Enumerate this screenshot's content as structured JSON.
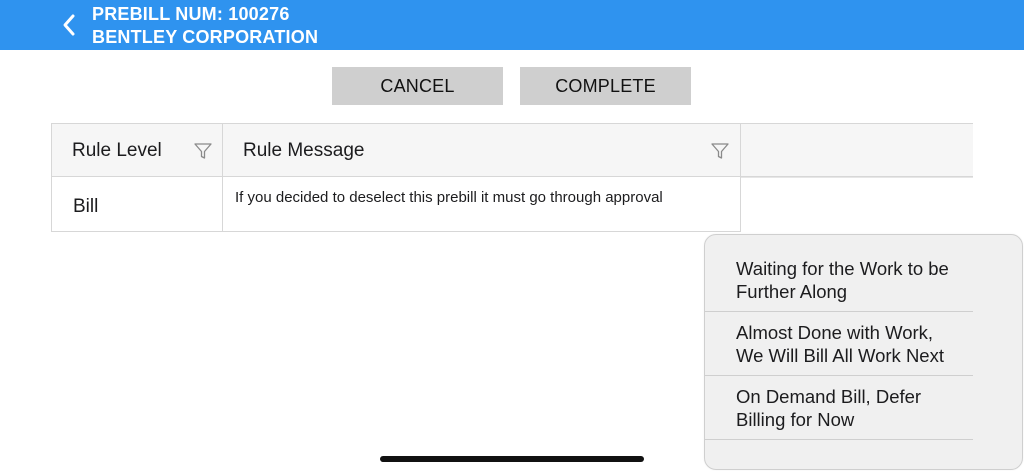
{
  "header": {
    "title_line1": "PREBILL NUM: 100276",
    "title_line2": "BENTLEY CORPORATION",
    "back_icon": "chevron-left-icon",
    "bg_color": "#2f93ef"
  },
  "actions": {
    "cancel_label": "CANCEL",
    "complete_label": "COMPLETE"
  },
  "table": {
    "columns": [
      "Rule Level",
      "Rule Message"
    ],
    "filter_icon": "filter-icon",
    "rows": [
      {
        "rule_level": "Bill",
        "rule_message": "If you decided to deselect this prebill it must go through approval"
      }
    ]
  },
  "popup": {
    "options": [
      {
        "line1": "Waiting for the Work to be",
        "line2": "Further Along"
      },
      {
        "line1": "Almost Done with Work,",
        "line2": "We Will Bill All Work Next"
      },
      {
        "line1": "On Demand Bill, Defer",
        "line2": "Billing for Now"
      }
    ]
  }
}
